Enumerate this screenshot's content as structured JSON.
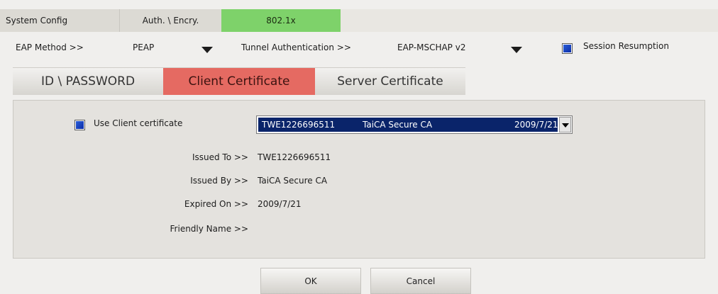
{
  "top_tabs": [
    {
      "label": "System Config",
      "active": false
    },
    {
      "label": "Auth. \\ Encry.",
      "active": false
    },
    {
      "label": "802.1x",
      "active": true
    }
  ],
  "eap": {
    "method_label": "EAP Method >>",
    "method_value": "PEAP",
    "tunnel_label": "Tunnel Authentication >>",
    "tunnel_value": "EAP-MSCHAP v2",
    "session_resumption_label": "Session Resumption",
    "session_resumption_checked": true
  },
  "sub_tabs": [
    {
      "label": "ID \\ PASSWORD",
      "active": false
    },
    {
      "label": "Client Certificate",
      "active": true
    },
    {
      "label": "Server Certificate",
      "active": false
    }
  ],
  "client_cert": {
    "use_label": "Use Client certificate",
    "use_checked": true,
    "selected": {
      "issued_to": "TWE1226696511",
      "issued_by": "TaiCA Secure CA",
      "expires": "2009/7/21"
    },
    "fields": {
      "issued_to_label": "Issued To >>",
      "issued_to_value": "TWE1226696511",
      "issued_by_label": "Issued By >>",
      "issued_by_value": "TaiCA Secure CA",
      "expired_on_label": "Expired On >>",
      "expired_on_value": "2009/7/21",
      "friendly_name_label": "Friendly Name >>",
      "friendly_name_value": ""
    }
  },
  "buttons": {
    "ok": "OK",
    "cancel": "Cancel"
  },
  "colors": {
    "active_top_tab": "#7ed26a",
    "active_sub_tab": "#e56a62",
    "selection": "#0a246a"
  }
}
